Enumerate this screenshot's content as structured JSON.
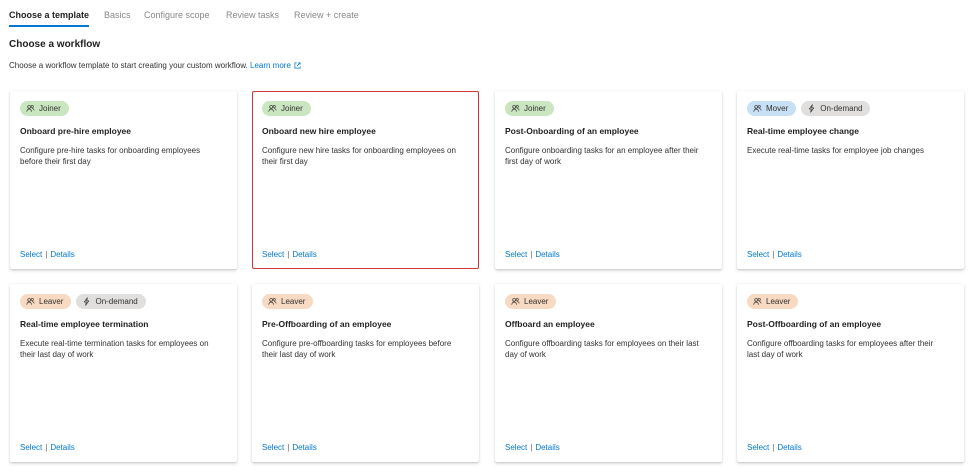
{
  "tabs": [
    {
      "label": "Choose a template",
      "active": true
    },
    {
      "label": "Basics",
      "active": false
    },
    {
      "label": "Configure scope",
      "active": false
    },
    {
      "label": "Review tasks",
      "active": false
    },
    {
      "label": "Review + create",
      "active": false
    }
  ],
  "heading": "Choose a workflow",
  "description": "Choose a workflow template to start creating your custom workflow.",
  "learn_more": "Learn more",
  "select_label": "Select",
  "separator": "|",
  "details_label": "Details",
  "tag_colors": {
    "Joiner": "#c9e6c0",
    "Mover": "#c7e0f4",
    "Leaver": "#f8d9c1",
    "On-demand": "#e1dfdd"
  },
  "tag_icons": {
    "Joiner": "people-icon",
    "Mover": "people-icon",
    "Leaver": "people-icon",
    "On-demand": "lightning-icon"
  },
  "selected_outline_color": "#d13438",
  "cards": [
    {
      "tags": [
        "Joiner"
      ],
      "title": "Onboard pre-hire employee",
      "body": "Configure pre-hire tasks for onboarding employees before their first day",
      "selected": false
    },
    {
      "tags": [
        "Joiner"
      ],
      "title": "Onboard new hire employee",
      "body": "Configure new hire tasks for onboarding employees on their first day",
      "selected": true
    },
    {
      "tags": [
        "Joiner"
      ],
      "title": "Post-Onboarding of an employee",
      "body": "Configure onboarding tasks for an employee after their first day of work",
      "selected": false
    },
    {
      "tags": [
        "Mover",
        "On-demand"
      ],
      "title": "Real-time employee change",
      "body": "Execute real-time tasks for employee job changes",
      "selected": false
    },
    {
      "tags": [
        "Leaver",
        "On-demand"
      ],
      "title": "Real-time employee termination",
      "body": "Execute real-time termination tasks for employees on their last day of work",
      "selected": false
    },
    {
      "tags": [
        "Leaver"
      ],
      "title": "Pre-Offboarding of an employee",
      "body": "Configure pre-offboarding tasks for employees before their last day of work",
      "selected": false
    },
    {
      "tags": [
        "Leaver"
      ],
      "title": "Offboard an employee",
      "body": "Configure offboarding tasks for employees on their last day of work",
      "selected": false
    },
    {
      "tags": [
        "Leaver"
      ],
      "title": "Post-Offboarding of an employee",
      "body": "Configure offboarding tasks for employees after their last day of work",
      "selected": false
    }
  ]
}
